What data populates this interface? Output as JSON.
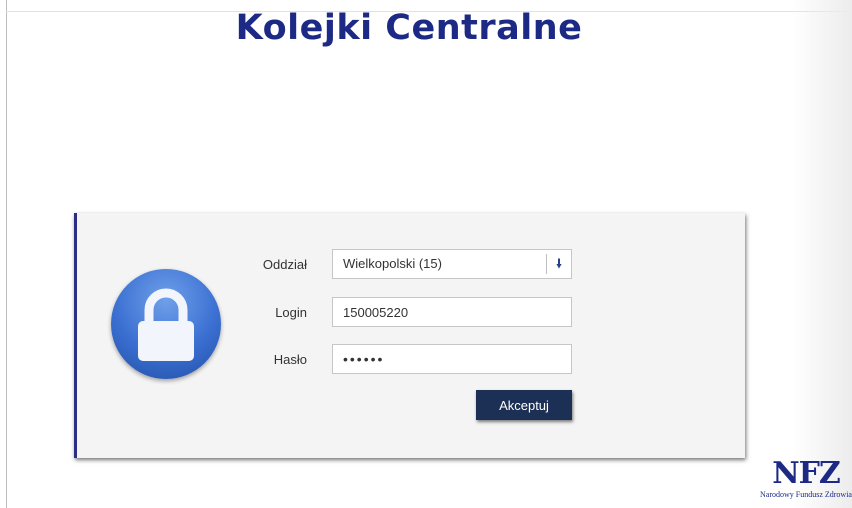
{
  "page": {
    "title": "Kolejki Centralne"
  },
  "form": {
    "oddzial_label": "Oddział",
    "oddzial_value": "Wielkopolski (15)",
    "login_label": "Login",
    "login_value": "150005220",
    "haslo_label": "Hasło",
    "haslo_mask": "••••••",
    "submit_label": "Akceptuj"
  },
  "logo": {
    "mark": "NFZ",
    "subtitle": "Narodowy Fundusz Zdrowia"
  },
  "icons": {
    "lock": "padlock-icon",
    "dropdown": "arrow-down-icon"
  },
  "colors": {
    "title": "#1c2a86",
    "button": "#1c2f55",
    "lock": "#3a6fd1"
  }
}
